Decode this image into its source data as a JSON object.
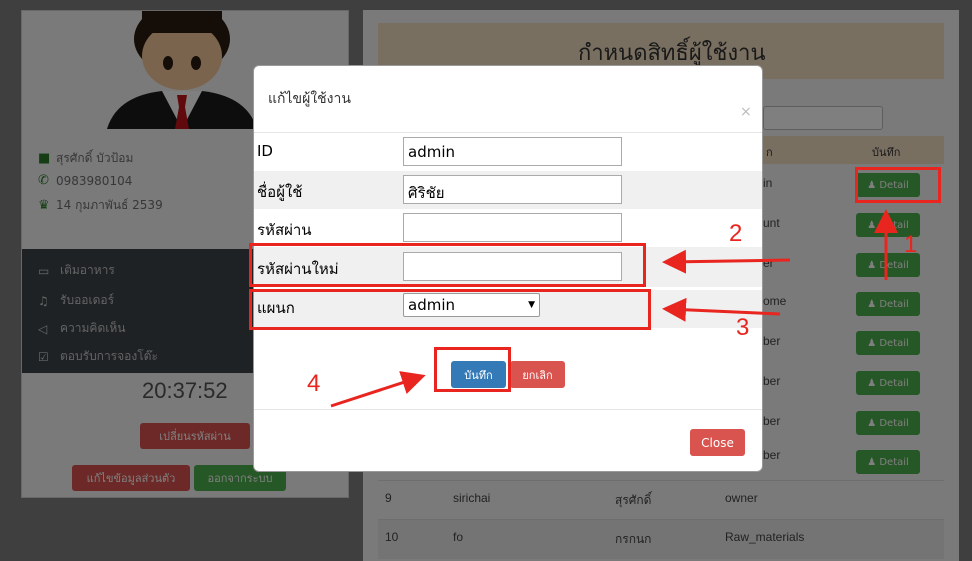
{
  "colors": {
    "accent_red": "#e8251e",
    "btn_green": "#4cae4c",
    "btn_red": "#d9534f",
    "btn_blue": "#337ab7",
    "header_bg": "#f2dec3"
  },
  "profile": {
    "name": "สุรศักดิ์ บัวป้อม",
    "phone": "0983980104",
    "birthday": "14 กุมภาพันธ์ 2539"
  },
  "menu": {
    "items": [
      {
        "label": "เติมอาหาร",
        "icon": "card-icon"
      },
      {
        "label": "รับออเดอร์",
        "icon": "bell-icon"
      },
      {
        "label": "ความคิดเห็น",
        "icon": "megaphone-icon"
      },
      {
        "label": "ตอบรับการจองโต๊ะ",
        "icon": "checkbox-icon"
      }
    ]
  },
  "clock": "20:37:52",
  "sidebar_buttons": {
    "change_password": "เปลี่ยนรหัสผ่าน",
    "edit_profile": "แก้ไขข้อมูลส่วนตัว",
    "logout": "ออกจากระบบ"
  },
  "page": {
    "title": "กำหนดสิทธิ์ผู้ใช้งาน",
    "columns": {
      "col_partial": "ก",
      "save": "บันทึก"
    },
    "detail_label": "Detail",
    "partial_rows": [
      "in",
      "unt",
      "er",
      "ome",
      "ber",
      "ber",
      "ber",
      "ber"
    ],
    "rows": [
      {
        "no": "9",
        "username": "sirichai",
        "name": "สุรศักดิ์",
        "dept": "owner"
      },
      {
        "no": "10",
        "username": "fo",
        "name": "กรกนก",
        "dept": "Raw_materials"
      }
    ]
  },
  "modal": {
    "title": "แก้ไขผู้ใช้งาน",
    "close_x": "×",
    "fields": {
      "id_label": "ID",
      "id_value": "admin",
      "name_label": "ชื่อผู้ใช้",
      "name_value": "ศิริชัย",
      "password_label": "รหัสผ่าน",
      "password_value": "",
      "new_password_label": "รหัสผ่านใหม่",
      "new_password_value": "",
      "dept_label": "แผนก",
      "dept_value": "admin"
    },
    "save_button": "บันทึก",
    "cancel_button": "ยกเลิก",
    "close_button": "Close"
  },
  "annotations": [
    "1",
    "2",
    "3",
    "4"
  ]
}
